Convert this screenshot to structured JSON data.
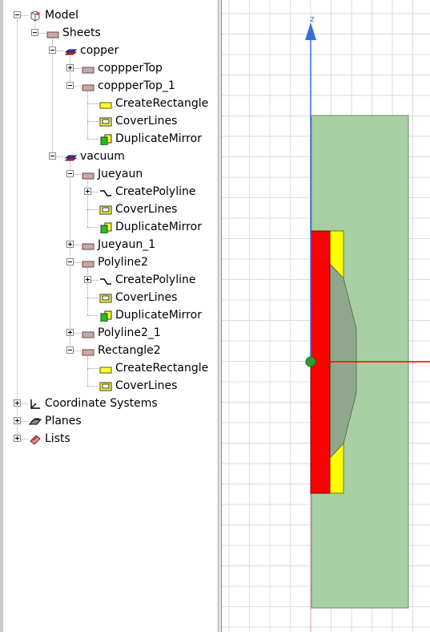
{
  "tree": {
    "rows": [
      {
        "label": "Model",
        "depth": 0,
        "exp": "minus",
        "icon": "model"
      },
      {
        "label": "Sheets",
        "depth": 1,
        "exp": "minus",
        "icon": "sheet"
      },
      {
        "label": "copper",
        "depth": 2,
        "exp": "minus",
        "icon": "material-copper"
      },
      {
        "label": "coppperTop",
        "depth": 3,
        "exp": "plus",
        "icon": "sheet"
      },
      {
        "label": "coppperTop_1",
        "depth": 3,
        "exp": "minus",
        "icon": "sheet"
      },
      {
        "label": "CreateRectangle",
        "depth": 4,
        "exp": null,
        "icon": "create-rectangle"
      },
      {
        "label": "CoverLines",
        "depth": 4,
        "exp": null,
        "icon": "cover-lines"
      },
      {
        "label": "DuplicateMirror",
        "depth": 4,
        "exp": null,
        "icon": "duplicate-mirror"
      },
      {
        "label": "vacuum",
        "depth": 2,
        "exp": "minus",
        "icon": "material-vacuum"
      },
      {
        "label": "Jueyaun",
        "depth": 3,
        "exp": "minus",
        "icon": "sheet"
      },
      {
        "label": "CreatePolyline",
        "depth": 4,
        "exp": "plus",
        "icon": "create-polyline"
      },
      {
        "label": "CoverLines",
        "depth": 4,
        "exp": null,
        "icon": "cover-lines"
      },
      {
        "label": "DuplicateMirror",
        "depth": 4,
        "exp": null,
        "icon": "duplicate-mirror"
      },
      {
        "label": "Jueyaun_1",
        "depth": 3,
        "exp": "plus",
        "icon": "sheet"
      },
      {
        "label": "Polyline2",
        "depth": 3,
        "exp": "minus",
        "icon": "sheet"
      },
      {
        "label": "CreatePolyline",
        "depth": 4,
        "exp": "plus",
        "icon": "create-polyline"
      },
      {
        "label": "CoverLines",
        "depth": 4,
        "exp": null,
        "icon": "cover-lines"
      },
      {
        "label": "DuplicateMirror",
        "depth": 4,
        "exp": null,
        "icon": "duplicate-mirror"
      },
      {
        "label": "Polyline2_1",
        "depth": 3,
        "exp": "plus",
        "icon": "sheet"
      },
      {
        "label": "Rectangle2",
        "depth": 3,
        "exp": "minus",
        "icon": "sheet"
      },
      {
        "label": "CreateRectangle",
        "depth": 4,
        "exp": null,
        "icon": "create-rectangle"
      },
      {
        "label": "CoverLines",
        "depth": 4,
        "exp": null,
        "icon": "cover-lines"
      },
      {
        "label": "Coordinate Systems",
        "depth": 0,
        "exp": "plus",
        "icon": "coordinate-systems"
      },
      {
        "label": "Planes",
        "depth": 0,
        "exp": "plus",
        "icon": "planes"
      },
      {
        "label": "Lists",
        "depth": 0,
        "exp": "plus",
        "icon": "lists"
      }
    ]
  },
  "viewport": {
    "axis_label": "z",
    "colors": {
      "vacuum_region": "#a8cfa4",
      "copper_red": "#ff0000",
      "copper_yellow": "#ffff00",
      "polyline_gray": "#8fa88c",
      "z_axis": "#3a6fd8",
      "x_axis": "#ff0000",
      "y_axis": "#d4a0a0",
      "origin": "#2aa02a",
      "grid": "#d6dbe8"
    }
  }
}
